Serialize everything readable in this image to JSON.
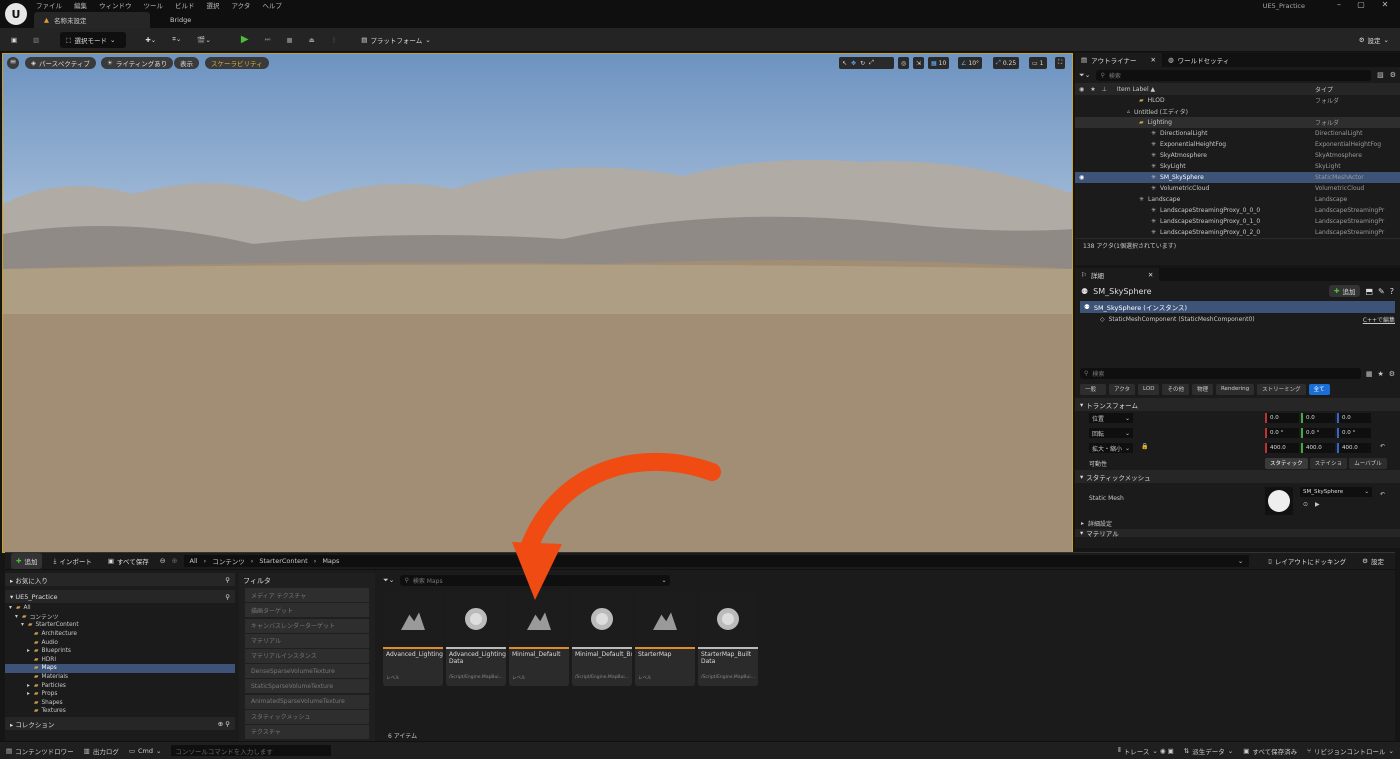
{
  "titlebar": {
    "menu": [
      "ファイル",
      "編集",
      "ウィンドウ",
      "ツール",
      "ビルド",
      "選択",
      "アクタ",
      "ヘルプ"
    ],
    "level_tab": "名称未設定",
    "bridge_tab": "Bridge",
    "project": "UE5_Practice"
  },
  "toolbar": {
    "mode": "選択モード",
    "platform": "プラットフォーム",
    "settings": "設定"
  },
  "viewport": {
    "perspective": "パースペクティブ",
    "lighting": "ライティングあり",
    "show": "表示",
    "scalability": "スケーラビリティ",
    "grid": "10",
    "angle": "10°",
    "scale": "0.25",
    "camera": "1"
  },
  "outliner": {
    "tab": "アウトライナー",
    "tab2": "ワールドセッティ",
    "search": "検索",
    "col_label": "Item Label ▲",
    "col_type": "タイプ",
    "rows": [
      {
        "label": "HLOD",
        "type": "フォルダ",
        "indent": 1
      },
      {
        "label": "Untitled (エディタ)",
        "type": "",
        "indent": 0
      },
      {
        "label": "Lighting",
        "type": "フォルダ",
        "indent": 1
      },
      {
        "label": "DirectionalLight",
        "type": "DirectionalLight",
        "indent": 2
      },
      {
        "label": "ExponentialHeightFog",
        "type": "ExponentialHeightFog",
        "indent": 2
      },
      {
        "label": "SkyAtmosphere",
        "type": "SkyAtmosphere",
        "indent": 2
      },
      {
        "label": "SkyLight",
        "type": "SkyLight",
        "indent": 2
      },
      {
        "label": "SM_SkySphere",
        "type": "StaticMeshActor",
        "indent": 2
      },
      {
        "label": "VolumetricCloud",
        "type": "VolumetricCloud",
        "indent": 2
      },
      {
        "label": "Landscape",
        "type": "Landscape",
        "indent": 1
      },
      {
        "label": "LandscapeStreamingProxy_0_0_0",
        "type": "LandscapeStreamingPr",
        "indent": 2
      },
      {
        "label": "LandscapeStreamingProxy_0_1_0",
        "type": "LandscapeStreamingPr",
        "indent": 2
      },
      {
        "label": "LandscapeStreamingProxy_0_2_0",
        "type": "LandscapeStreamingPr",
        "indent": 2
      },
      {
        "label": "LandscapeStreamingProxy_0_3_0",
        "type": "LandscapeStreamingPr",
        "indent": 2
      }
    ],
    "count": "138 アクタ(1個選択されています)"
  },
  "details": {
    "tab": "詳細",
    "actor": "SM_SkySphere",
    "add": "追加",
    "instance": "SM_SkySphere (インスタンス)",
    "component": "StaticMeshComponent (StaticMeshComponent0)",
    "edit_link": "C++で編集",
    "search": "検索",
    "tabs": [
      "一般",
      "アクタ",
      "LOD",
      "その他",
      "物理",
      "Rendering",
      "ストリーミング",
      "全て"
    ],
    "transform": "トランスフォーム",
    "loc_label": "位置",
    "rot_label": "回転",
    "scale_label": "拡大・縮小",
    "loc": [
      "0.0",
      "0.0",
      "0.0"
    ],
    "rot": [
      "0.0 °",
      "0.0 °",
      "0.0 °"
    ],
    "scale": [
      "400.0",
      "400.0",
      "400.0"
    ],
    "mobility": "可動性",
    "mob_options": [
      "スタティック",
      "ステイショ",
      "ムーバブル"
    ],
    "static_mesh_section": "スタティックメッシュ",
    "static_mesh_label": "Static Mesh",
    "static_mesh_value": "SM_SkySphere",
    "advanced": "詳細設定",
    "material": "マテリアル"
  },
  "content": {
    "add": "追加",
    "import": "インポート",
    "save_all": "すべて保存",
    "path": [
      "All",
      "コンテンツ",
      "StarterContent",
      "Maps"
    ],
    "dock": "レイアウトにドッキング",
    "settings": "設定",
    "favorites": "お気に入り",
    "project": "UE5_Practice",
    "tree": [
      {
        "label": "All",
        "indent": 0
      },
      {
        "label": "コンテンツ",
        "indent": 1
      },
      {
        "label": "StarterContent",
        "indent": 2
      },
      {
        "label": "Architecture",
        "indent": 3
      },
      {
        "label": "Audio",
        "indent": 3
      },
      {
        "label": "Blueprints",
        "indent": 3
      },
      {
        "label": "HDRI",
        "indent": 3
      },
      {
        "label": "Maps",
        "indent": 3
      },
      {
        "label": "Materials",
        "indent": 3
      },
      {
        "label": "Particles",
        "indent": 3
      },
      {
        "label": "Props",
        "indent": 3
      },
      {
        "label": "Shapes",
        "indent": 3
      },
      {
        "label": "Textures",
        "indent": 3
      }
    ],
    "collections": "コレクション",
    "filter_title": "フィルタ",
    "filters": [
      "メディア テクスチャ",
      "描画ターゲット",
      "キャンバスレンダーターゲット",
      "マテリアル",
      "マテリアルインスタンス",
      "DenseSparseVolumeTexture",
      "StaticSparseVolumeTexture",
      "AnimatedSparseVolumeTexture",
      "スタティックメッシュ",
      "テクスチャ"
    ],
    "search": "検索 Maps",
    "assets": [
      {
        "name": "Advanced_Lighting",
        "type": "レベル",
        "kind": "level"
      },
      {
        "name": "Advanced_Lighting_Built Data",
        "type": "/Script/Engine.MapBui...",
        "kind": "data"
      },
      {
        "name": "Minimal_Default",
        "type": "レベル",
        "kind": "level"
      },
      {
        "name": "Minimal_Default_BuiltData",
        "type": "/Script/Engine.MapBui...",
        "kind": "data"
      },
      {
        "name": "StarterMap",
        "type": "レベル",
        "kind": "level"
      },
      {
        "name": "StarterMap_Built Data",
        "type": "/Script/Engine.MapBui...",
        "kind": "data"
      }
    ],
    "item_count": "6 アイテム"
  },
  "status": {
    "drawer": "コンテンツドロワー",
    "log": "出力ログ",
    "cmd": "Cmd",
    "cmd_placeholder": "コンソールコマンドを入力します",
    "trace": "トレース",
    "derived": "派生データ",
    "save_all": "すべて保存済み",
    "revision": "リビジョンコントロール"
  },
  "colors": {
    "accent": "#c9a227",
    "selected": "#3d5378",
    "arrow": "#f04b12",
    "play": "#4fbf3a"
  }
}
